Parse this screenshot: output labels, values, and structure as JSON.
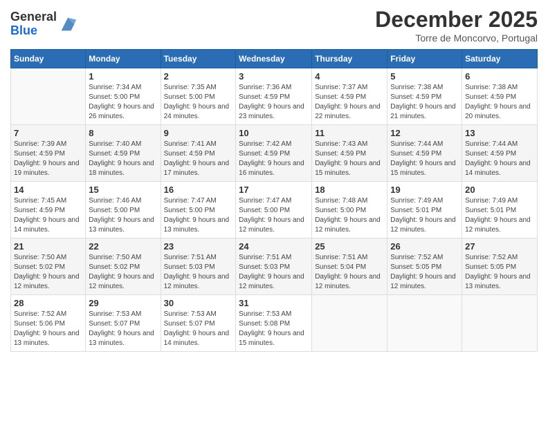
{
  "header": {
    "logo_general": "General",
    "logo_blue": "Blue",
    "month_title": "December 2025",
    "location": "Torre de Moncorvo, Portugal"
  },
  "weekdays": [
    "Sunday",
    "Monday",
    "Tuesday",
    "Wednesday",
    "Thursday",
    "Friday",
    "Saturday"
  ],
  "weeks": [
    [
      {
        "day": "",
        "sunrise": "",
        "sunset": "",
        "daylight": ""
      },
      {
        "day": "1",
        "sunrise": "Sunrise: 7:34 AM",
        "sunset": "Sunset: 5:00 PM",
        "daylight": "Daylight: 9 hours and 26 minutes."
      },
      {
        "day": "2",
        "sunrise": "Sunrise: 7:35 AM",
        "sunset": "Sunset: 5:00 PM",
        "daylight": "Daylight: 9 hours and 24 minutes."
      },
      {
        "day": "3",
        "sunrise": "Sunrise: 7:36 AM",
        "sunset": "Sunset: 4:59 PM",
        "daylight": "Daylight: 9 hours and 23 minutes."
      },
      {
        "day": "4",
        "sunrise": "Sunrise: 7:37 AM",
        "sunset": "Sunset: 4:59 PM",
        "daylight": "Daylight: 9 hours and 22 minutes."
      },
      {
        "day": "5",
        "sunrise": "Sunrise: 7:38 AM",
        "sunset": "Sunset: 4:59 PM",
        "daylight": "Daylight: 9 hours and 21 minutes."
      },
      {
        "day": "6",
        "sunrise": "Sunrise: 7:38 AM",
        "sunset": "Sunset: 4:59 PM",
        "daylight": "Daylight: 9 hours and 20 minutes."
      }
    ],
    [
      {
        "day": "7",
        "sunrise": "Sunrise: 7:39 AM",
        "sunset": "Sunset: 4:59 PM",
        "daylight": "Daylight: 9 hours and 19 minutes."
      },
      {
        "day": "8",
        "sunrise": "Sunrise: 7:40 AM",
        "sunset": "Sunset: 4:59 PM",
        "daylight": "Daylight: 9 hours and 18 minutes."
      },
      {
        "day": "9",
        "sunrise": "Sunrise: 7:41 AM",
        "sunset": "Sunset: 4:59 PM",
        "daylight": "Daylight: 9 hours and 17 minutes."
      },
      {
        "day": "10",
        "sunrise": "Sunrise: 7:42 AM",
        "sunset": "Sunset: 4:59 PM",
        "daylight": "Daylight: 9 hours and 16 minutes."
      },
      {
        "day": "11",
        "sunrise": "Sunrise: 7:43 AM",
        "sunset": "Sunset: 4:59 PM",
        "daylight": "Daylight: 9 hours and 15 minutes."
      },
      {
        "day": "12",
        "sunrise": "Sunrise: 7:44 AM",
        "sunset": "Sunset: 4:59 PM",
        "daylight": "Daylight: 9 hours and 15 minutes."
      },
      {
        "day": "13",
        "sunrise": "Sunrise: 7:44 AM",
        "sunset": "Sunset: 4:59 PM",
        "daylight": "Daylight: 9 hours and 14 minutes."
      }
    ],
    [
      {
        "day": "14",
        "sunrise": "Sunrise: 7:45 AM",
        "sunset": "Sunset: 4:59 PM",
        "daylight": "Daylight: 9 hours and 14 minutes."
      },
      {
        "day": "15",
        "sunrise": "Sunrise: 7:46 AM",
        "sunset": "Sunset: 5:00 PM",
        "daylight": "Daylight: 9 hours and 13 minutes."
      },
      {
        "day": "16",
        "sunrise": "Sunrise: 7:47 AM",
        "sunset": "Sunset: 5:00 PM",
        "daylight": "Daylight: 9 hours and 13 minutes."
      },
      {
        "day": "17",
        "sunrise": "Sunrise: 7:47 AM",
        "sunset": "Sunset: 5:00 PM",
        "daylight": "Daylight: 9 hours and 12 minutes."
      },
      {
        "day": "18",
        "sunrise": "Sunrise: 7:48 AM",
        "sunset": "Sunset: 5:00 PM",
        "daylight": "Daylight: 9 hours and 12 minutes."
      },
      {
        "day": "19",
        "sunrise": "Sunrise: 7:49 AM",
        "sunset": "Sunset: 5:01 PM",
        "daylight": "Daylight: 9 hours and 12 minutes."
      },
      {
        "day": "20",
        "sunrise": "Sunrise: 7:49 AM",
        "sunset": "Sunset: 5:01 PM",
        "daylight": "Daylight: 9 hours and 12 minutes."
      }
    ],
    [
      {
        "day": "21",
        "sunrise": "Sunrise: 7:50 AM",
        "sunset": "Sunset: 5:02 PM",
        "daylight": "Daylight: 9 hours and 12 minutes."
      },
      {
        "day": "22",
        "sunrise": "Sunrise: 7:50 AM",
        "sunset": "Sunset: 5:02 PM",
        "daylight": "Daylight: 9 hours and 12 minutes."
      },
      {
        "day": "23",
        "sunrise": "Sunrise: 7:51 AM",
        "sunset": "Sunset: 5:03 PM",
        "daylight": "Daylight: 9 hours and 12 minutes."
      },
      {
        "day": "24",
        "sunrise": "Sunrise: 7:51 AM",
        "sunset": "Sunset: 5:03 PM",
        "daylight": "Daylight: 9 hours and 12 minutes."
      },
      {
        "day": "25",
        "sunrise": "Sunrise: 7:51 AM",
        "sunset": "Sunset: 5:04 PM",
        "daylight": "Daylight: 9 hours and 12 minutes."
      },
      {
        "day": "26",
        "sunrise": "Sunrise: 7:52 AM",
        "sunset": "Sunset: 5:05 PM",
        "daylight": "Daylight: 9 hours and 12 minutes."
      },
      {
        "day": "27",
        "sunrise": "Sunrise: 7:52 AM",
        "sunset": "Sunset: 5:05 PM",
        "daylight": "Daylight: 9 hours and 13 minutes."
      }
    ],
    [
      {
        "day": "28",
        "sunrise": "Sunrise: 7:52 AM",
        "sunset": "Sunset: 5:06 PM",
        "daylight": "Daylight: 9 hours and 13 minutes."
      },
      {
        "day": "29",
        "sunrise": "Sunrise: 7:53 AM",
        "sunset": "Sunset: 5:07 PM",
        "daylight": "Daylight: 9 hours and 13 minutes."
      },
      {
        "day": "30",
        "sunrise": "Sunrise: 7:53 AM",
        "sunset": "Sunset: 5:07 PM",
        "daylight": "Daylight: 9 hours and 14 minutes."
      },
      {
        "day": "31",
        "sunrise": "Sunrise: 7:53 AM",
        "sunset": "Sunset: 5:08 PM",
        "daylight": "Daylight: 9 hours and 15 minutes."
      },
      {
        "day": "",
        "sunrise": "",
        "sunset": "",
        "daylight": ""
      },
      {
        "day": "",
        "sunrise": "",
        "sunset": "",
        "daylight": ""
      },
      {
        "day": "",
        "sunrise": "",
        "sunset": "",
        "daylight": ""
      }
    ]
  ]
}
